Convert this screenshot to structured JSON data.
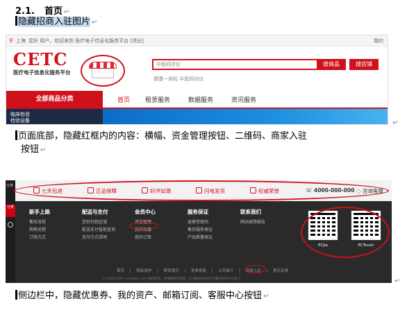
{
  "heading": {
    "number": "2.1.",
    "title": "首页",
    "mark": "↵"
  },
  "note1": "隐藏招商入驻图片",
  "note2_line1": "页面底部，隐藏红框内的内容：横幅、资金管理按钮、二维码、商家入驻",
  "note2_line2": "按钮",
  "note3": "侧边栏中，隐藏优惠券、我的资产、邮箱订阅、客服中心按钮",
  "para_mark": "↵",
  "shot1": {
    "topbar": {
      "location": "上海",
      "greeting": "您好  用户，欢迎来到 医疗电子信息化服务平台 [退出]",
      "right": "我的"
    },
    "logo_text": "CETC",
    "logo_sub": "医疗电子信息化服务平台",
    "search_placeholder": "中医四诊仪",
    "search_btn": "搜商品",
    "shop_btn": "搜店铺",
    "hot_words": "健康一体机    中医四诊仪",
    "category": "全部商品分类",
    "nav": [
      "首页",
      "租赁服务",
      "数据服务",
      "资讯服务"
    ],
    "side_items": [
      "临床检验",
      "检验设备"
    ]
  },
  "shot2": {
    "left": {
      "top": "分类",
      "mid": "分类\n三",
      "bottom": ""
    },
    "services": [
      "七天包退",
      "正品保障",
      "好评如潮",
      "闪电发货",
      "权威荣誉"
    ],
    "phone": "4000-000-000",
    "kefu": "咨询客服",
    "columns": [
      {
        "title": "新手上路",
        "items": [
          "售后流程",
          "购物流程",
          "订购方式"
        ]
      },
      {
        "title": "配送与支付",
        "items": [
          "货到付款区域",
          "配送支付智能查询",
          "支付方式说明"
        ]
      },
      {
        "title": "会员中心",
        "items": [
          "资金管理",
          "我的收藏",
          "我的订单"
        ]
      },
      {
        "title": "服务保证",
        "items": [
          "退换货原则",
          "售后服务保证",
          "产品质量保证"
        ]
      },
      {
        "title": "联系我们",
        "items": [
          "网站故障报告"
        ]
      }
    ],
    "qr_labels": [
      "ECJia",
      "ECTouch"
    ],
    "footer_links": "首页 | 隐私保护 | 联系我们 | 免责条款 | 公司简介 | 商家入驻 | 意见反馈",
    "copyright": "© 2005-2017 ecmoban.com 版权所有，并保留所有权利。ICP备案证书号:ICP备08000315号-1"
  }
}
